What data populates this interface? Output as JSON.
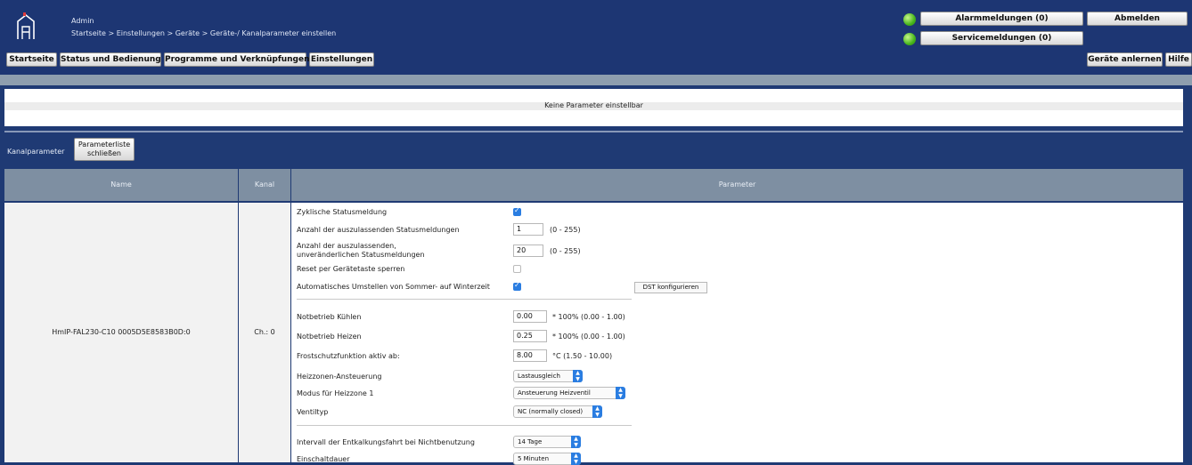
{
  "header": {
    "user": "Admin",
    "breadcrumb": "Startseite > Einstellungen > Geräte > Geräte-/ Kanalparameter einstellen",
    "alarm_label": "Alarmmeldungen (0)",
    "service_label": "Servicemeldungen (0)",
    "logout_label": "Abmelden",
    "led_color": "#46b51b",
    "logo_icon": "house-logo-icon"
  },
  "nav": {
    "items": [
      "Startseite",
      "Status und Bedienung",
      "Programme und Verknüpfungen",
      "Einstellungen"
    ],
    "right": [
      "Geräte anlernen",
      "Hilfe"
    ]
  },
  "info": {
    "message": "Keine Parameter einstellbar"
  },
  "channel": {
    "section_label": "Kanalparameter",
    "close_button_line1": "Parameterliste",
    "close_button_line2": "schließen"
  },
  "table": {
    "headers": [
      "Name",
      "Kanal",
      "Parameter"
    ],
    "device_name": "HmIP-FAL230-C10 0005D5E8583B0D:0",
    "channel": "Ch.: 0"
  },
  "params": {
    "zyklisch": {
      "label": "Zyklische Statusmeldung",
      "checked": true
    },
    "auszulassend": {
      "label": "Anzahl der auszulassenden Statusmeldungen",
      "value": "1",
      "range": "(0 - 255)"
    },
    "unveraenderlich": {
      "label_line1": "Anzahl der auszulassenden,",
      "label_line2": "unveränderlichen Statusmeldungen",
      "value": "20",
      "range": "(0 - 255)"
    },
    "reset": {
      "label": "Reset per Gerätetaste sperren",
      "checked": false
    },
    "sommerzeit": {
      "label": "Automatisches Umstellen von Sommer- auf Winterzeit",
      "checked": true,
      "dst_button": "DST konfigurieren"
    },
    "kuehlen": {
      "label": "Notbetrieb Kühlen",
      "value": "0.00",
      "range": "* 100% (0.00 - 1.00)"
    },
    "heizen": {
      "label": "Notbetrieb Heizen",
      "value": "0.25",
      "range": "* 100% (0.00 - 1.00)"
    },
    "frostschutz": {
      "label": "Frostschutzfunktion aktiv ab:",
      "value": "8.00",
      "range": "°C (1.50 - 10.00)"
    },
    "heizzonen": {
      "label": "Heizzonen-Ansteuerung",
      "selected": "Lastausgleich"
    },
    "modus": {
      "label": "Modus für Heizzone 1",
      "selected": "Ansteuerung Heizventil"
    },
    "ventiltyp": {
      "label": "Ventiltyp",
      "selected": "NC (normally closed)"
    },
    "intervall": {
      "label": "Intervall der Entkalkungsfahrt bei Nichtbenutzung",
      "selected": "14 Tage"
    },
    "einschaltdauer": {
      "label": "Einschaltdauer",
      "selected": "5 Minuten"
    }
  }
}
